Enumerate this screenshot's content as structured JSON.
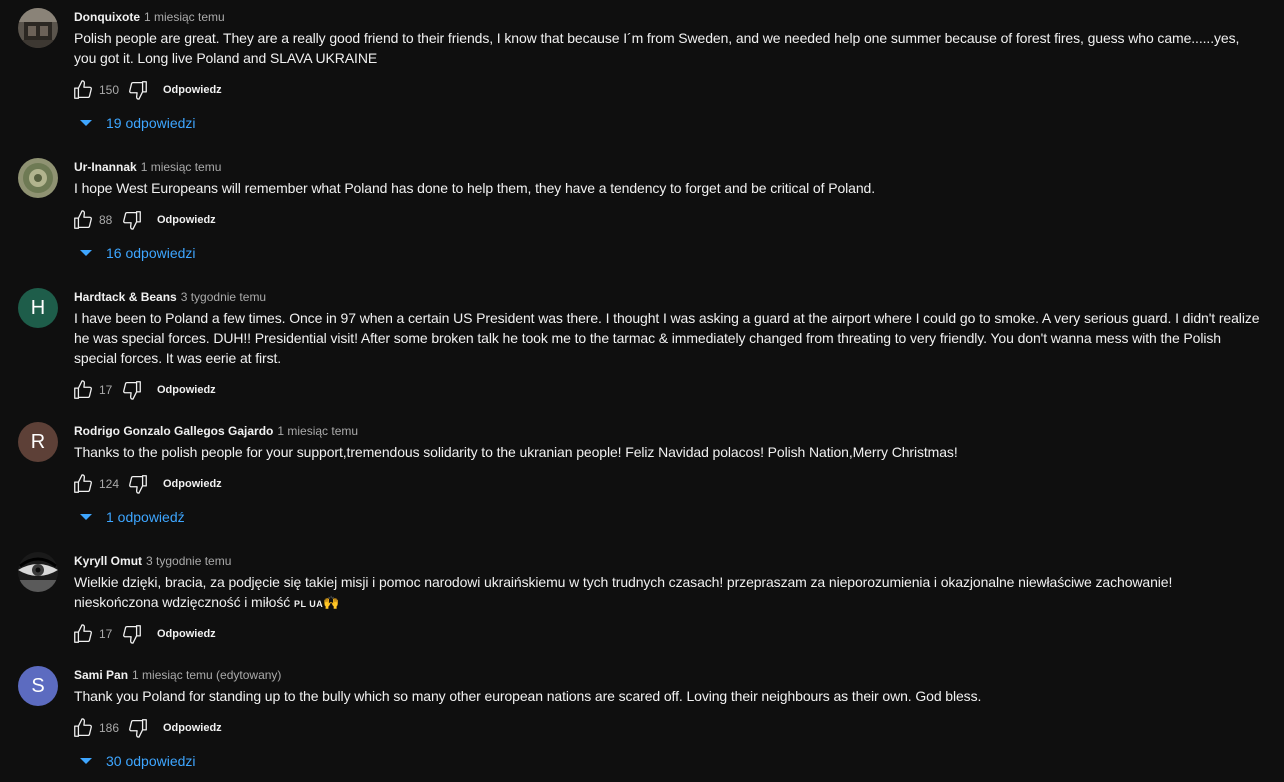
{
  "ui": {
    "reply_label": "Odpowiedz"
  },
  "comments": [
    {
      "author": "Donquixote",
      "time": "1 miesiąc temu",
      "avatar": {
        "type": "photo",
        "name": "donquixote-avatar"
      },
      "text": "Polish people are great. They are a really good friend to their friends, I know that because I´m from Sweden, and we needed help one summer because of forest fires, guess who came......yes, you got it. Long live Poland and SLAVA UKRAINE",
      "likes": "150",
      "replies": "19 odpowiedzi"
    },
    {
      "author": "Ur-Inannak",
      "time": "1 miesiąc temu",
      "avatar": {
        "type": "photo",
        "name": "ur-inannak-avatar"
      },
      "text": "I hope West Europeans will remember what Poland has done to help them, they have a tendency to forget and be critical of Poland.",
      "likes": "88",
      "replies": "16 odpowiedzi"
    },
    {
      "author": "Hardtack & Beans",
      "time": "3 tygodnie temu",
      "avatar": {
        "type": "letter",
        "letter": "H",
        "color": "#1e5d4a"
      },
      "text": "I have been to Poland a few times. Once in 97 when a certain US President was there. I thought I was asking a guard at the airport where I could go to smoke. A very serious guard. I didn't realize he was special forces. DUH!! Presidential visit! After some broken talk he took me to the tarmac & immediately changed from threating to very friendly. You don't wanna mess with the Polish special forces. It was eerie at first.",
      "likes": "17"
    },
    {
      "author": "Rodrigo Gonzalo Gallegos Gajardo",
      "time": "1 miesiąc temu",
      "avatar": {
        "type": "letter",
        "letter": "R",
        "color": "#5d4037"
      },
      "text": "Thanks to the polish people for your support,tremendous solidarity to the ukranian people! Feliz Navidad polacos! Polish Nation,Merry Christmas!",
      "likes": "124",
      "replies": "1 odpowiedź"
    },
    {
      "author": "Kyryll Omut",
      "time": "3 tygodnie temu",
      "avatar": {
        "type": "photo",
        "name": "kyryll-omut-avatar"
      },
      "text": "Wielkie dzięki, bracia, za podjęcie się takiej misji i pomoc narodowi ukraińskiemu w tych trudnych czasach! przepraszam za nieporozumienia i okazjonalne niewłaściwe zachowanie! nieskończona wdzięczność i miłość",
      "flags": "PL UA",
      "emoji": "🙌",
      "likes": "17"
    },
    {
      "author": "Sami Pan",
      "time": "1 miesiąc temu (edytowany)",
      "avatar": {
        "type": "letter",
        "letter": "S",
        "color": "#5c6bc0"
      },
      "text": "Thank you Poland for standing up to the bully which so many other european nations are scared off. Loving their neighbours as their own. God bless.",
      "likes": "186",
      "replies": "30 odpowiedzi"
    }
  ]
}
